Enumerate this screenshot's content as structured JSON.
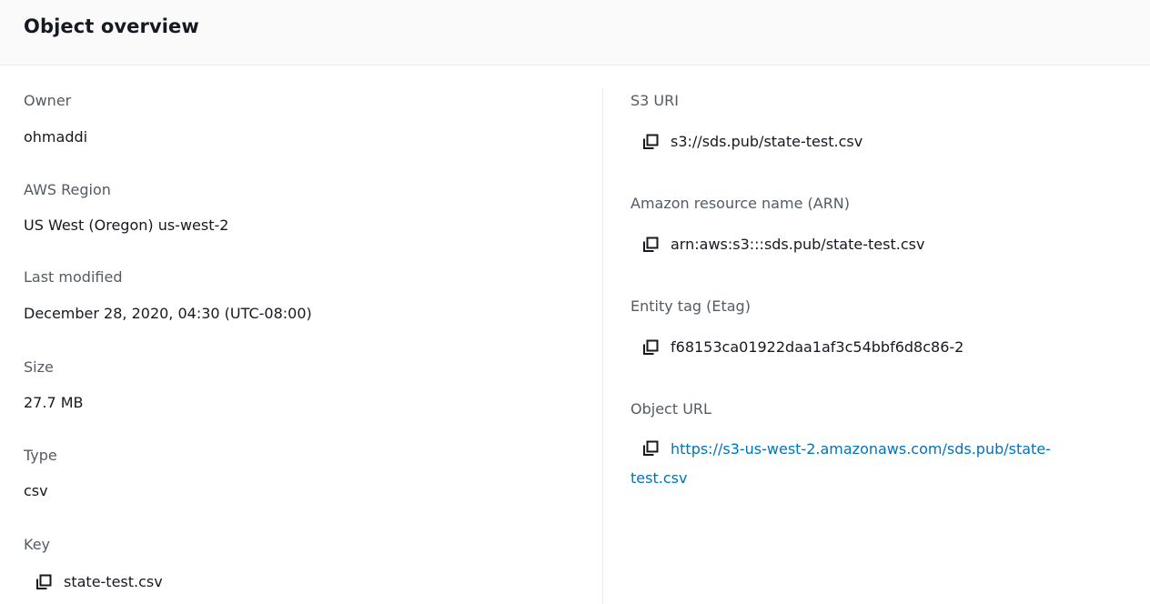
{
  "header": {
    "title": "Object overview"
  },
  "left": {
    "owner": {
      "label": "Owner",
      "value": "ohmaddi"
    },
    "region": {
      "label": "AWS Region",
      "value": "US West (Oregon) us-west-2"
    },
    "last_modified": {
      "label": "Last modified",
      "value": "December 28, 2020, 04:30 (UTC-08:00)"
    },
    "size": {
      "label": "Size",
      "value": "27.7 MB"
    },
    "type": {
      "label": "Type",
      "value": "csv"
    },
    "key": {
      "label": "Key",
      "value": "state-test.csv"
    }
  },
  "right": {
    "s3_uri": {
      "label": "S3 URI",
      "value": "s3://sds.pub/state-test.csv"
    },
    "arn": {
      "label": "Amazon resource name (ARN)",
      "value": "arn:aws:s3:::sds.pub/state-test.csv"
    },
    "etag": {
      "label": "Entity tag (Etag)",
      "value": "f68153ca01922daa1af3c54bbf6d8c86-2"
    },
    "object_url": {
      "label": "Object URL",
      "value": "https://s3-us-west-2.amazonaws.com/sds.pub/state-test.csv",
      "line1": "https://s3-us-west-2.amazonaws.com/sds.pub/state-",
      "line2": "test.csv"
    }
  },
  "icons": {
    "copy": "copy-icon"
  },
  "colors": {
    "header_bg": "#fafafa",
    "label": "#545b64",
    "text": "#16191f",
    "link": "#0073bb",
    "divider": "#eaeded"
  }
}
